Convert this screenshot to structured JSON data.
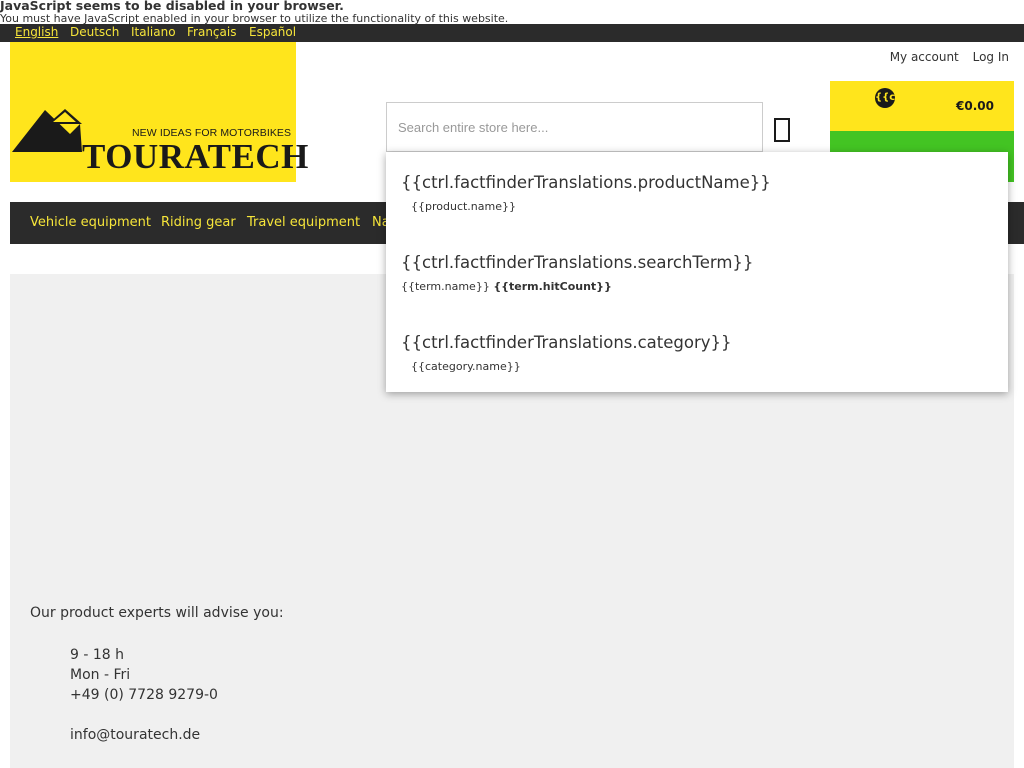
{
  "noscript": {
    "title": "JavaScript seems to be disabled in your browser.",
    "message": "You must have JavaScript enabled in your browser to utilize the functionality of this website."
  },
  "languages": [
    "English",
    "Deutsch",
    "Italiano",
    "Français",
    "Español"
  ],
  "active_language": "English",
  "logo": {
    "tagline": "NEW IDEAS FOR MOTORBIKES",
    "brand": "TOURATECH"
  },
  "account": {
    "my_account": "My account",
    "login": "Log In"
  },
  "search": {
    "placeholder": "Search entire store here..."
  },
  "cart": {
    "badge": "{{c",
    "total": "€0.00"
  },
  "nav": [
    "Vehicle equipment",
    "Riding gear",
    "Travel equipment",
    "Na"
  ],
  "suggest": {
    "product_heading": "{{ctrl.factfinderTranslations.productName}}",
    "product_item": "{{product.name}}",
    "term_heading": "{{ctrl.factfinderTranslations.searchTerm}}",
    "term_item": "{{term.name}}",
    "term_count": "{{term.hitCount}}",
    "category_heading": "{{ctrl.factfinderTranslations.category}}",
    "category_item": "{{category.name}}"
  },
  "contact": {
    "advise": "Our product experts will advise you:",
    "hours": "9 - 18 h",
    "days": "Mon - Fri",
    "phone": "+49 (0) 7728 9279-0",
    "email": "info@touratech.de"
  },
  "colors": {
    "brand_yellow": "#ffe51c",
    "nav_dark": "#2b2b2b",
    "cart_green": "#43c423"
  }
}
